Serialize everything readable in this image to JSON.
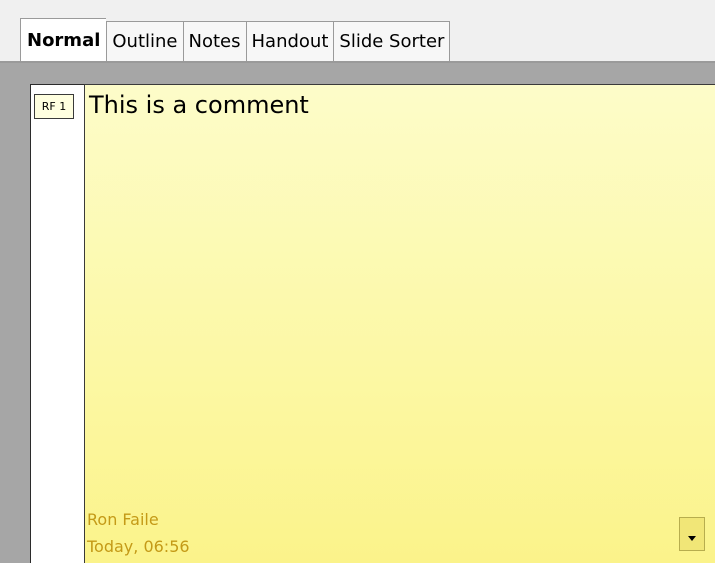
{
  "tabs": [
    {
      "label": "Normal",
      "active": true
    },
    {
      "label": "Outline",
      "active": false
    },
    {
      "label": "Notes",
      "active": false
    },
    {
      "label": "Handout",
      "active": false
    },
    {
      "label": "Slide Sorter",
      "active": false
    }
  ],
  "comment": {
    "marker_label": "RF 1",
    "text": "This is a comment",
    "author": "Ron Faile",
    "date": "Today, 06:56",
    "menu_icon": "chevron-down-icon",
    "background_color": "#fcf8a4",
    "meta_color": "#c49a17"
  }
}
